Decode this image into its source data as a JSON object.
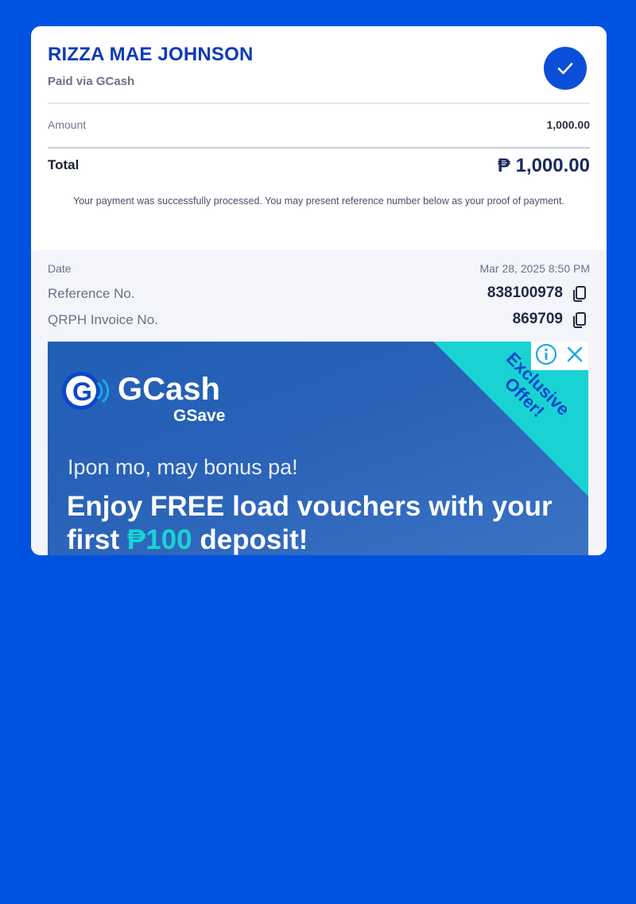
{
  "receipt": {
    "payee_name": "RIZZA MAE JOHNSON",
    "paid_via": "Paid via GCash",
    "amount_label": "Amount",
    "amount_value": "1,000.00",
    "total_label": "Total",
    "total_value": "₱ 1,000.00",
    "success_message": "Your payment was successfully processed. You may present reference number below as your proof of payment."
  },
  "details": {
    "date_label": "Date",
    "date_value": "Mar 28, 2025 8:50 PM",
    "reference_label": "Reference No.",
    "reference_value": "838100978",
    "qrph_label": "QRPH Invoice No.",
    "qrph_value": "869709"
  },
  "ad": {
    "brand": "GCash",
    "product": "GSave",
    "corner_badge": "Exclusive Offer!",
    "tagline": "Ipon mo, may bonus pa!",
    "headline_part1": "Enjoy FREE load vouchers with your first ",
    "headline_highlight": "₱100",
    "headline_part2": " deposit!"
  },
  "colors": {
    "background": "#0052e0",
    "accent": "#0b4fd8",
    "ad_teal": "#19d3d3"
  },
  "icons": [
    "check-icon",
    "copy-icon",
    "info-icon",
    "close-icon",
    "gcash-logo-icon"
  ]
}
